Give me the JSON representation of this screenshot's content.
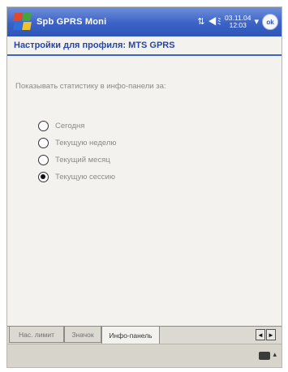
{
  "titlebar": {
    "app_title": "Spb GPRS Moni",
    "clock_date": "03.11.04",
    "clock_time": "12:03",
    "ok_label": "ok",
    "tray_icons": [
      "signal-transfer-icon",
      "volume-icon"
    ]
  },
  "header": {
    "title": "Настройки для профиля: MTS GPRS"
  },
  "content": {
    "label": "Показывать статистику в инфо-панели за:",
    "options": [
      {
        "label": "Сегодня",
        "selected": false
      },
      {
        "label": "Текущую неделю",
        "selected": false
      },
      {
        "label": "Текущий месяц",
        "selected": false
      },
      {
        "label": "Текущую сессию",
        "selected": true
      }
    ]
  },
  "tabs": [
    {
      "label": "Нас. лимит",
      "active": false
    },
    {
      "label": "Значок",
      "active": false
    },
    {
      "label": "Инфо-панель",
      "active": true
    }
  ],
  "tab_scroll": {
    "left": "◄",
    "right": "►"
  },
  "command_bar": {
    "input_icon": "keyboard-icon",
    "arrow": "▴"
  }
}
